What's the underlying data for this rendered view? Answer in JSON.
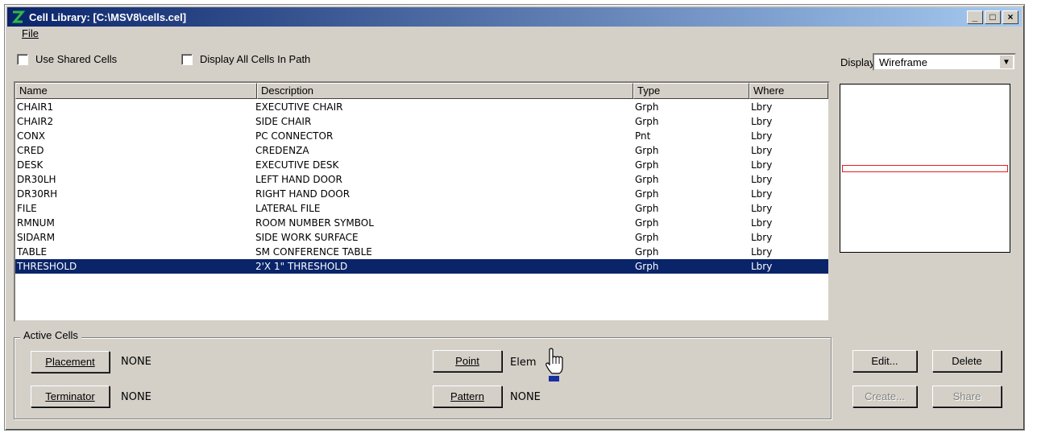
{
  "window": {
    "title": "Cell Library: [C:\\MSV8\\cells.cel]",
    "buttons": {
      "minimize": "_",
      "maximize": "□",
      "close": "×"
    }
  },
  "menu": {
    "file": "File"
  },
  "options": {
    "use_shared_cells": {
      "label": "Use Shared Cells",
      "checked": false
    },
    "display_all_cells": {
      "label": "Display All Cells In Path",
      "checked": false
    }
  },
  "display": {
    "label": "Display:",
    "value": "Wireframe"
  },
  "columns": [
    "Name",
    "Description",
    "Type",
    "Where"
  ],
  "cells": [
    {
      "name": "CHAIR1",
      "description": "EXECUTIVE CHAIR",
      "type": "Grph",
      "where": "Lbry"
    },
    {
      "name": "CHAIR2",
      "description": "SIDE CHAIR",
      "type": "Grph",
      "where": "Lbry"
    },
    {
      "name": "CONX",
      "description": "PC CONNECTOR",
      "type": "Pnt",
      "where": "Lbry"
    },
    {
      "name": "CRED",
      "description": "CREDENZA",
      "type": "Grph",
      "where": "Lbry"
    },
    {
      "name": "DESK",
      "description": "EXECUTIVE DESK",
      "type": "Grph",
      "where": "Lbry"
    },
    {
      "name": "DR30LH",
      "description": "LEFT HAND DOOR",
      "type": "Grph",
      "where": "Lbry"
    },
    {
      "name": "DR30RH",
      "description": "RIGHT HAND DOOR",
      "type": "Grph",
      "where": "Lbry"
    },
    {
      "name": "FILE",
      "description": "LATERAL FILE",
      "type": "Grph",
      "where": "Lbry"
    },
    {
      "name": "RMNUM",
      "description": "ROOM NUMBER SYMBOL",
      "type": "Grph",
      "where": "Lbry"
    },
    {
      "name": "SIDARM",
      "description": "SIDE WORK SURFACE",
      "type": "Grph",
      "where": "Lbry"
    },
    {
      "name": "TABLE",
      "description": "SM CONFERENCE TABLE",
      "type": "Grph",
      "where": "Lbry"
    },
    {
      "name": "THRESHOLD",
      "description": "2'X 1\" THRESHOLD",
      "type": "Grph",
      "where": "Lbry",
      "selected": true
    }
  ],
  "active_cells": {
    "group_label": "Active Cells",
    "placement": {
      "label": "Placement",
      "value": "NONE"
    },
    "terminator": {
      "label": "Terminator",
      "value": "NONE"
    },
    "point": {
      "label": "Point",
      "value": "Elem"
    },
    "pattern": {
      "label": "Pattern",
      "value": "NONE"
    }
  },
  "actions": {
    "edit": "Edit...",
    "delete": "Delete",
    "create": "Create...",
    "share": "Share"
  },
  "icons": {
    "app": "microstation-logo-icon",
    "cursor": "hand-pointer-icon"
  },
  "colors": {
    "titlebar_start": "#0a246a",
    "titlebar_end": "#a6caf0",
    "selection": "#0a246a",
    "preview_shape": "#e02020"
  }
}
